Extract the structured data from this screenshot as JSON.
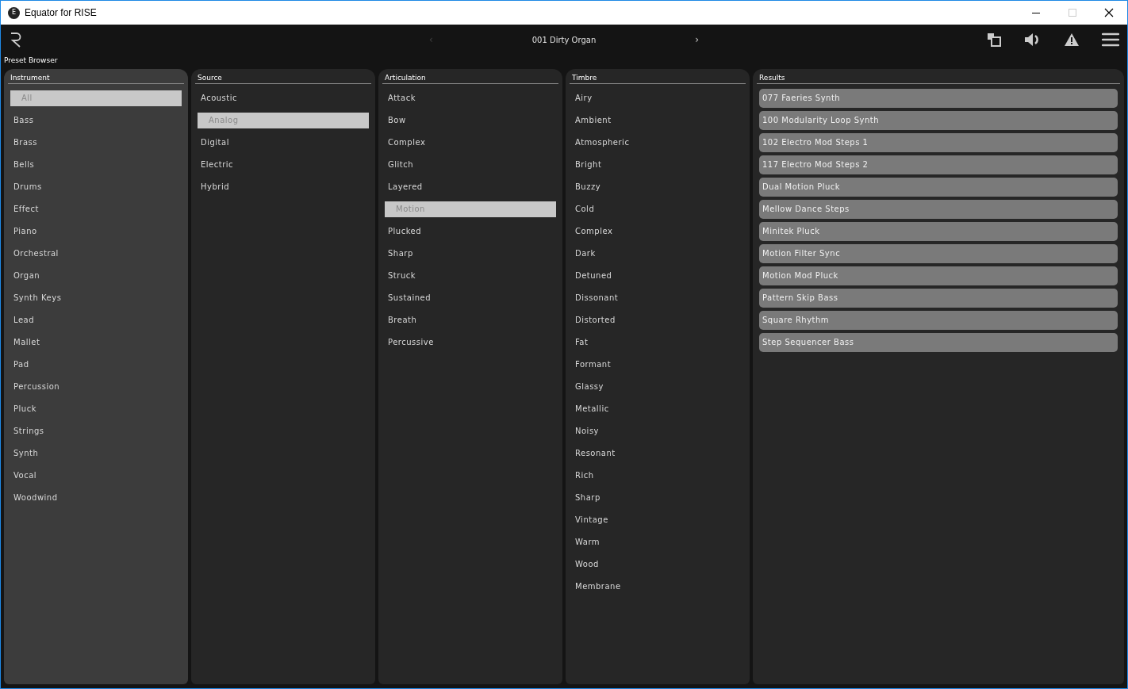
{
  "window": {
    "title": "Equator for RISE",
    "logo_letter": "E"
  },
  "toolbar": {
    "preset": "001 Dirty Organ",
    "prev": "‹",
    "next": "›"
  },
  "section_title": "Preset Browser",
  "columns": [
    {
      "title": "Instrument",
      "focused": true,
      "items": [
        {
          "label": "All",
          "selected": true
        },
        {
          "label": "Bass",
          "selected": false
        },
        {
          "label": "Brass",
          "selected": false
        },
        {
          "label": "Bells",
          "selected": false
        },
        {
          "label": "Drums",
          "selected": false
        },
        {
          "label": "Effect",
          "selected": false
        },
        {
          "label": "Piano",
          "selected": false
        },
        {
          "label": "Orchestral",
          "selected": false
        },
        {
          "label": "Organ",
          "selected": false
        },
        {
          "label": "Synth Keys",
          "selected": false
        },
        {
          "label": "Lead",
          "selected": false
        },
        {
          "label": "Mallet",
          "selected": false
        },
        {
          "label": "Pad",
          "selected": false
        },
        {
          "label": "Percussion",
          "selected": false
        },
        {
          "label": "Pluck",
          "selected": false
        },
        {
          "label": "Strings",
          "selected": false
        },
        {
          "label": "Synth",
          "selected": false
        },
        {
          "label": "Vocal",
          "selected": false
        },
        {
          "label": "Woodwind",
          "selected": false
        }
      ]
    },
    {
      "title": "Source",
      "focused": false,
      "items": [
        {
          "label": "Acoustic",
          "selected": false
        },
        {
          "label": "Analog",
          "selected": true
        },
        {
          "label": "Digital",
          "selected": false
        },
        {
          "label": "Electric",
          "selected": false
        },
        {
          "label": "Hybrid",
          "selected": false
        }
      ]
    },
    {
      "title": "Articulation",
      "focused": false,
      "items": [
        {
          "label": "Attack",
          "selected": false
        },
        {
          "label": "Bow",
          "selected": false
        },
        {
          "label": "Complex",
          "selected": false
        },
        {
          "label": "Glitch",
          "selected": false
        },
        {
          "label": "Layered",
          "selected": false
        },
        {
          "label": "Motion",
          "selected": true
        },
        {
          "label": "Plucked",
          "selected": false
        },
        {
          "label": "Sharp",
          "selected": false
        },
        {
          "label": "Struck",
          "selected": false
        },
        {
          "label": "Sustained",
          "selected": false
        },
        {
          "label": "Breath",
          "selected": false
        },
        {
          "label": "Percussive",
          "selected": false
        }
      ]
    },
    {
      "title": "Timbre",
      "focused": false,
      "items": [
        {
          "label": "Airy",
          "selected": false
        },
        {
          "label": "Ambient",
          "selected": false
        },
        {
          "label": "Atmospheric",
          "selected": false
        },
        {
          "label": "Bright",
          "selected": false
        },
        {
          "label": "Buzzy",
          "selected": false
        },
        {
          "label": "Cold",
          "selected": false
        },
        {
          "label": "Complex",
          "selected": false
        },
        {
          "label": "Dark",
          "selected": false
        },
        {
          "label": "Detuned",
          "selected": false
        },
        {
          "label": "Dissonant",
          "selected": false
        },
        {
          "label": "Distorted",
          "selected": false
        },
        {
          "label": "Fat",
          "selected": false
        },
        {
          "label": "Formant",
          "selected": false
        },
        {
          "label": "Glassy",
          "selected": false
        },
        {
          "label": "Metallic",
          "selected": false
        },
        {
          "label": "Noisy",
          "selected": false
        },
        {
          "label": "Resonant",
          "selected": false
        },
        {
          "label": "Rich",
          "selected": false
        },
        {
          "label": "Sharp",
          "selected": false
        },
        {
          "label": "Vintage",
          "selected": false
        },
        {
          "label": "Warm",
          "selected": false
        },
        {
          "label": "Wood",
          "selected": false
        },
        {
          "label": "Membrane",
          "selected": false
        }
      ]
    }
  ],
  "results": {
    "title": "Results",
    "items": [
      "077 Faeries Synth",
      "100 Modularity Loop Synth",
      "102 Electro Mod Steps 1",
      "117 Electro Mod Steps 2",
      "Dual Motion Pluck",
      "Mellow Dance Steps",
      "Minitek Pluck",
      "Motion Filter Sync",
      "Motion Mod Pluck",
      "Pattern Skip Bass",
      "Square Rhythm",
      "Step Sequencer Bass"
    ]
  }
}
